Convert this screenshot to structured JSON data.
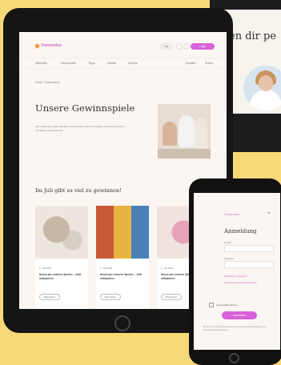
{
  "monitor": {
    "heading": "en dir pe"
  },
  "tablet": {
    "header": {
      "logo_text": "Famundus",
      "lang": "DE",
      "login_label": "Login"
    },
    "nav": {
      "items": [
        "Aktuelles",
        "Gesundheit",
        "Tipps",
        "Schule",
        "Service",
        "Kontakt",
        "Suche"
      ]
    },
    "breadcrumb": "Home  ›  Gewinnspiele",
    "page_title": "Unsere Gewinnspiele",
    "intro": "Hier findest du unsere aktuellen Gewinnspiele rund um Familie, Kinder und Freizeit – mitmachen und gewinnen!",
    "section_title": "Im Juli gibt es viel zu gewinnen!",
    "cards": [
      {
        "meta": "1. Juli 2024",
        "title": "Neues aus unseren Spielen – Jetzt mitmachen!",
        "button": "Mitmachen"
      },
      {
        "meta": "1. Juli 2024",
        "title": "Neues aus unseren Spielen – Jetzt mitmachen!",
        "button": "Mitmachen"
      },
      {
        "meta": "1. Juli 2024",
        "title": "Neues aus unseren Spielen – Jetzt mitmachen!",
        "button": "Mitmachen"
      }
    ]
  },
  "phone": {
    "logo_text": "Famundus",
    "close_icon": "×",
    "heading": "Anmeldung",
    "fields": [
      {
        "label": "E-Mail"
      },
      {
        "label": "Passwort"
      }
    ],
    "links": [
      "Passwort vergessen?",
      "Noch kein Konto? Registrieren"
    ],
    "checkbox_label": "Angemeldet bleiben",
    "submit_label": "Anmelden",
    "note": "Mit der Anmeldung akzeptierst du unsere Nutzungsbedingungen und Datenschutzbestimmungen."
  },
  "colors": {
    "background": "#f7d977",
    "accent": "#d860d8",
    "logo_mark": "#e8a23c"
  }
}
